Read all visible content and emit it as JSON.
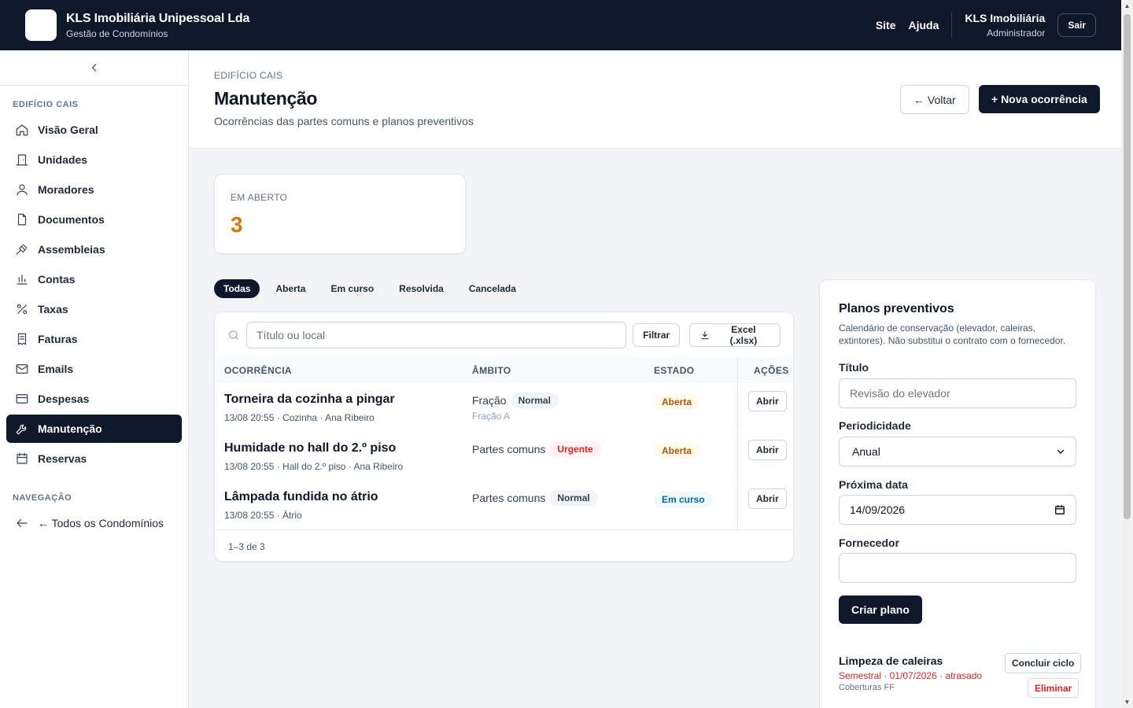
{
  "topbar": {
    "brand_name": "KLS Imobiliária Unipessoal Lda",
    "brand_sub": "Gestão de Condomínios",
    "links": [
      "Site",
      "Ajuda"
    ],
    "user_name": "KLS Imobiliária",
    "user_role": "Administrador",
    "logout_label": "Sair"
  },
  "sidebar": {
    "section_building": "EDIFÍCIO CAIS",
    "items": [
      {
        "label": "Visão Geral",
        "icon": "home-icon"
      },
      {
        "label": "Unidades",
        "icon": "door-icon"
      },
      {
        "label": "Moradores",
        "icon": "user-icon"
      },
      {
        "label": "Documentos",
        "icon": "file-icon"
      },
      {
        "label": "Assembleias",
        "icon": "gavel-icon"
      },
      {
        "label": "Contas",
        "icon": "bar-chart-icon"
      },
      {
        "label": "Taxas",
        "icon": "percent-icon"
      },
      {
        "label": "Faturas",
        "icon": "receipt-icon"
      },
      {
        "label": "Emails",
        "icon": "mail-icon"
      },
      {
        "label": "Despesas",
        "icon": "credit-card-icon"
      },
      {
        "label": "Manutenção",
        "icon": "wrench-icon"
      },
      {
        "label": "Reservas",
        "icon": "calendar-icon"
      }
    ],
    "active": "Manutenção",
    "section_nav": "NAVEGAÇÃO",
    "back_all": "← Todos os Condomínios"
  },
  "header": {
    "breadcrumb": "EDIFÍCIO CAIS",
    "title": "Manutenção",
    "subtitle": "Ocorrências das partes comuns e planos preventivos",
    "back_button": "← Voltar",
    "new_button": "+ Nova ocorrência"
  },
  "stat": {
    "label": "EM ABERTO",
    "value": "3"
  },
  "tabs": [
    "Todas",
    "Aberta",
    "Em curso",
    "Resolvida",
    "Cancelada"
  ],
  "active_tab": "Todas",
  "table": {
    "search_placeholder": "Título ou local",
    "filter_button": "Filtrar",
    "export_button": "Excel (.xlsx)",
    "columns": [
      "OCORRÊNCIA",
      "ÂMBITO",
      "ESTADO",
      "AÇÕES"
    ],
    "rows": [
      {
        "title": "Torneira da cozinha a pingar",
        "meta": "13/08 20:55 · Cozinha · Ana Ribeiro",
        "scope": "Fração",
        "priority": "Normal",
        "scope_sub": "Fração A",
        "status": "Aberta",
        "action": "Abrir"
      },
      {
        "title": "Humidade no hall do 2.º piso",
        "meta": "13/08 20:55 · Hall do 2.º piso · Ana Ribeiro",
        "scope": "Partes comuns",
        "priority": "Urgente",
        "scope_sub": "",
        "status": "Aberta",
        "action": "Abrir"
      },
      {
        "title": "Lâmpada fundida no átrio",
        "meta": "13/08 20:55 · Átrio",
        "scope": "Partes comuns",
        "priority": "Normal",
        "scope_sub": "",
        "status": "Em curso",
        "action": "Abrir"
      }
    ],
    "footer": "1–3 de 3"
  },
  "plans": {
    "title": "Planos preventivos",
    "description": "Calendário de conservação (elevador, caleiras, extintores). Não substitui o contrato com o fornecedor.",
    "title_label": "Título",
    "title_placeholder": "Revisão do elevador",
    "period_label": "Periodicidade",
    "period_value": "Anual",
    "next_date_label": "Próxima data",
    "next_date_value": "14/09/2026",
    "supplier_label": "Fornecedor",
    "supplier_value": "",
    "create_button": "Criar plano",
    "item": {
      "title": "Limpeza de caleiras",
      "due": "Semestral · 01/07/2026 · atrasado",
      "supplier": "Coberturas FF",
      "complete_button": "Concluir ciclo",
      "delete_button": "Eliminar"
    }
  },
  "colors": {
    "primary": "#0f172a",
    "open_stat": "#d97706",
    "danger": "#dc2626"
  }
}
